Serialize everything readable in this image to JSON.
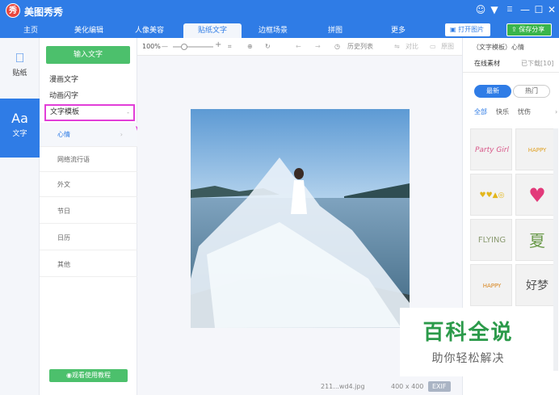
{
  "app": {
    "logo_text": "秀",
    "name": "美图秀秀"
  },
  "window": {
    "msg_icon": "chat-icon",
    "menu_icon": "dropdown-icon",
    "min": "—",
    "max": "☐",
    "close": "✕"
  },
  "tabs": [
    "主页",
    "美化编辑",
    "人像美容",
    "贴纸文字",
    "边框场景",
    "拼图",
    "更多"
  ],
  "active_tab": 3,
  "top_buttons": {
    "open": "打开图片",
    "save": "保存分享"
  },
  "leftnav": {
    "sticker": "贴纸",
    "text": "文字",
    "text_icon": "Aa"
  },
  "panel": {
    "input_button": "输入文字",
    "menu": [
      "漫画文字",
      "动画闪字"
    ],
    "active_menu": "文字模板",
    "active_arrow": "-",
    "sub_items": [
      "心情",
      "网络流行语",
      "外文",
      "节日",
      "日历",
      "其他"
    ],
    "sub_arrow": "›",
    "tutorial": "观看使用教程"
  },
  "toolbar": {
    "zoom": "100%",
    "minus": "—",
    "plus": "+",
    "history": "历史列表",
    "compare": "对比",
    "original": "原图"
  },
  "status": {
    "filename": "211...wd4.jpg",
    "size": "400 x 400",
    "exif": "EXIF"
  },
  "right": {
    "title": "（文字模板）心情",
    "tab_online": "在线素材",
    "tab_downloaded": "已下载[10]",
    "pill_new": "最新",
    "pill_hot": "热门",
    "cats": [
      "全部",
      "快乐",
      "忧伤"
    ],
    "cat_more": "›",
    "stickers": [
      "Party Girl",
      "HAPPY",
      "♥♥▲◎",
      "♥",
      "FLYING",
      "夏",
      "HAPPY",
      "好梦"
    ]
  },
  "watermark": {
    "big": "百科全说",
    "small": "助你轻松解决"
  },
  "colors": {
    "accent": "#2f7ce6",
    "green": "#4cc06c",
    "highlight": "#e23ed8"
  }
}
